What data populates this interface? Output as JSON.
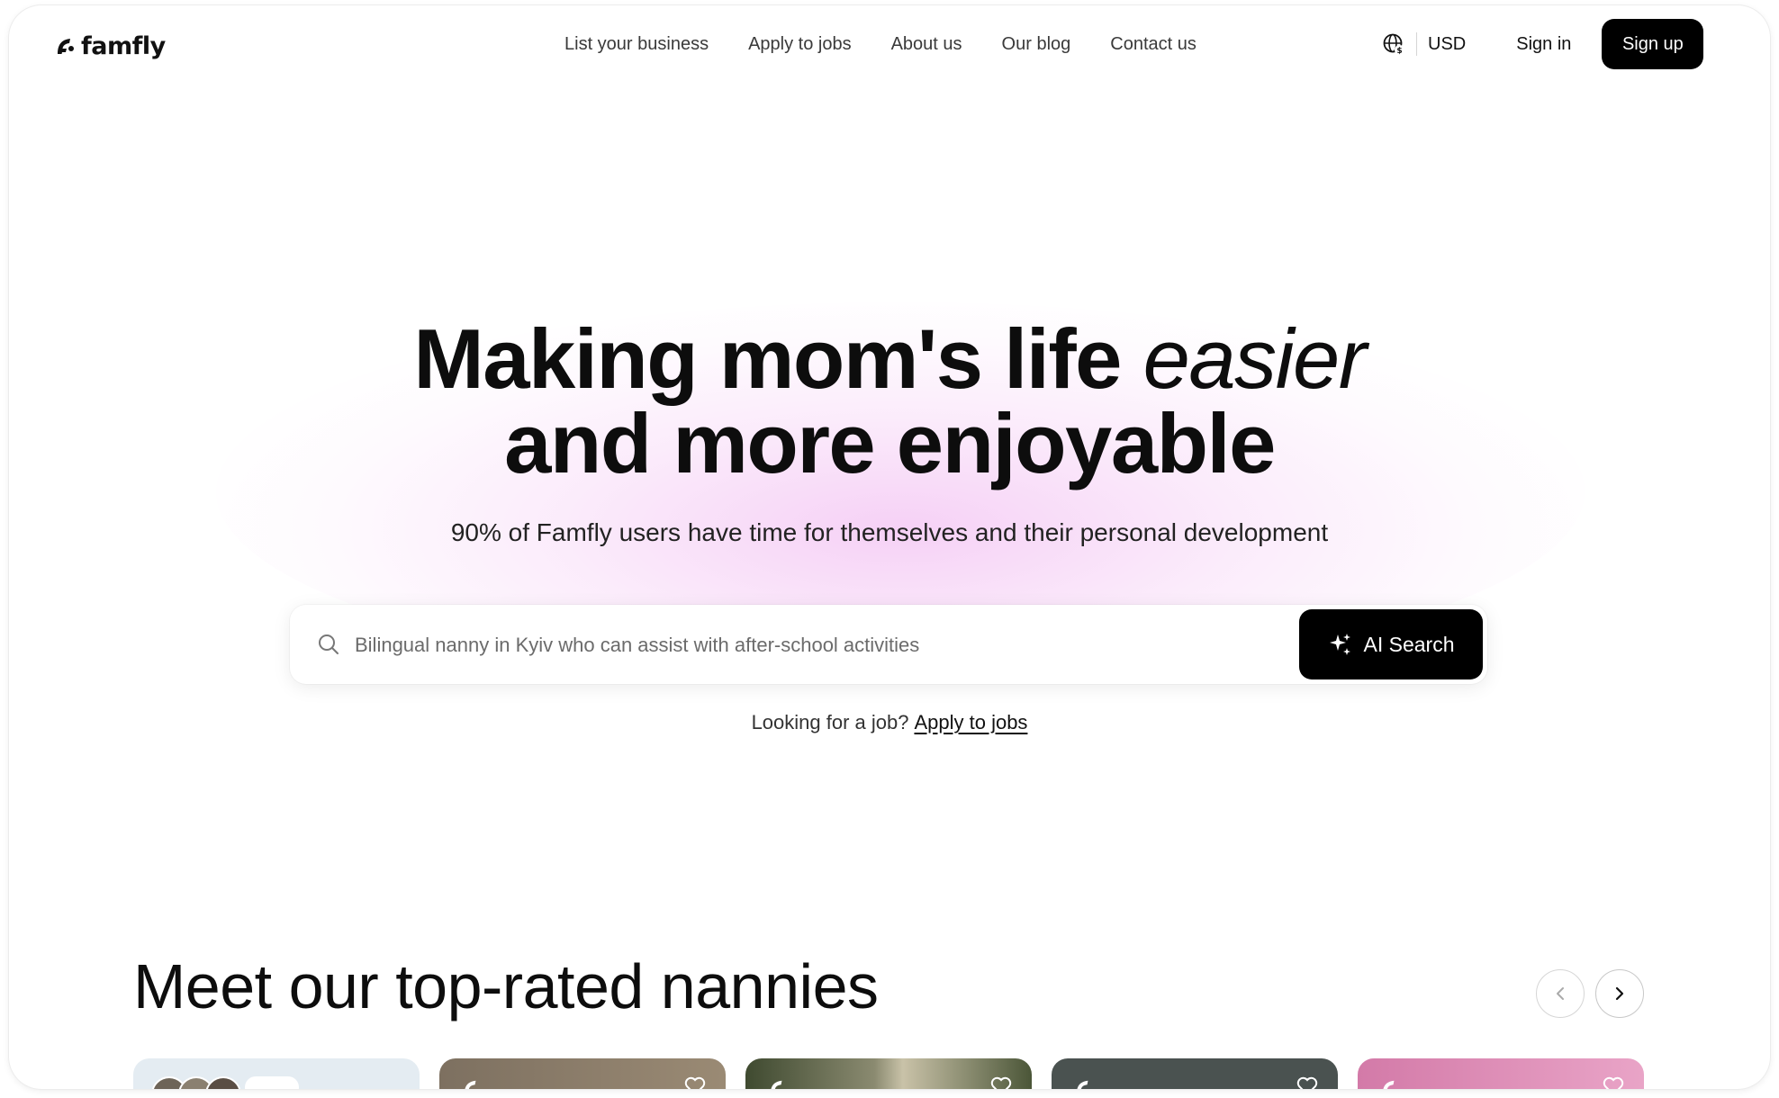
{
  "brand": {
    "name": "famfly"
  },
  "nav": {
    "items": [
      {
        "label": "List your business"
      },
      {
        "label": "Apply to jobs"
      },
      {
        "label": "About us"
      },
      {
        "label": "Our blog"
      },
      {
        "label": "Contact us"
      }
    ]
  },
  "header": {
    "currency": "USD",
    "currency_icon": "globe-currency-icon",
    "signin_label": "Sign in",
    "signup_label": "Sign up"
  },
  "hero": {
    "title_line1": "Making mom's life ",
    "title_italic": "easier",
    "title_line2": "and more enjoyable",
    "subtitle": "90% of Famfly users have time for themselves and their personal development",
    "search": {
      "placeholder": "Bilingual nanny in Kyiv who can assist with after-school activities",
      "button_label": "AI Search",
      "button_icon": "sparkles-icon",
      "search_icon": "search-icon"
    },
    "job_prompt": "Looking for a job?",
    "job_link": "Apply to jobs"
  },
  "nannies": {
    "title": "Meet our top-rated nannies",
    "prev_icon": "chevron-left-icon",
    "next_icon": "chevron-right-icon",
    "cards": [
      {
        "bg": "#e4ecf2"
      },
      {
        "bg": "#8a7a68"
      },
      {
        "bg": "#4f5a3e"
      },
      {
        "bg": "#4a5250"
      },
      {
        "bg": "#d98ab5"
      }
    ]
  },
  "colors": {
    "accent": "#000000",
    "glow": "#eeaaee",
    "text": "#111111"
  }
}
